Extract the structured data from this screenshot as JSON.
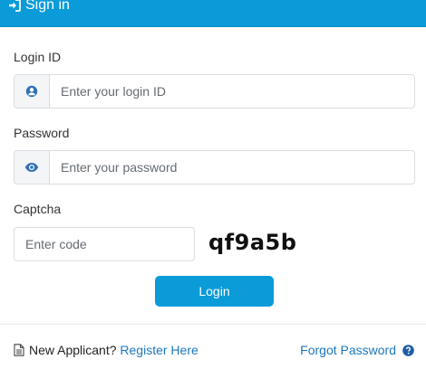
{
  "header": {
    "title": "Sign in",
    "icon": "sign-in-icon"
  },
  "login_id": {
    "label": "Login ID",
    "placeholder": "Enter your login ID",
    "icon": "user-circle-icon"
  },
  "password": {
    "label": "Password",
    "placeholder": "Enter your password",
    "icon": "eye-icon"
  },
  "captcha": {
    "label": "Captcha",
    "placeholder": "Enter code",
    "code": "qf9a5b"
  },
  "login_button": {
    "label": "Login"
  },
  "footer": {
    "new_applicant_text": "New Applicant?",
    "register_link": "Register Here",
    "forgot_link": "Forgot Password",
    "doc_icon": "document-icon",
    "help_icon": "question-circle-icon"
  },
  "colors": {
    "primary": "#0b9bd8",
    "link": "#1d77bd",
    "icon": "#3a7fc4"
  }
}
